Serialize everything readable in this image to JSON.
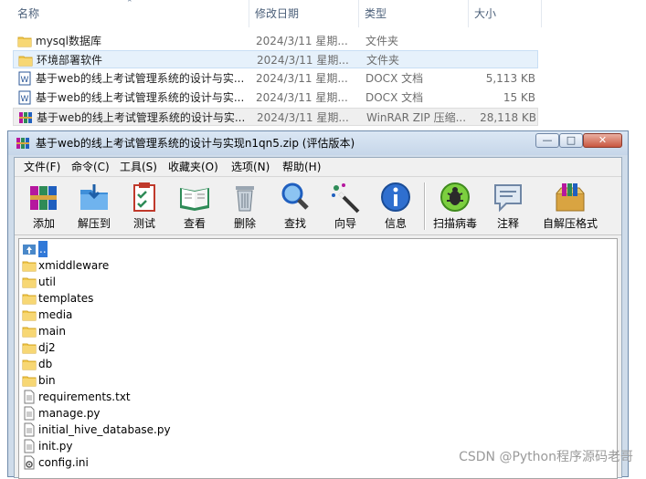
{
  "explorer": {
    "columns": {
      "name": "名称",
      "date": "修改日期",
      "type": "类型",
      "size": "大小"
    },
    "rows": [
      {
        "icon": "folder-icon",
        "name": "mysql数据库",
        "date": "2024/3/11 星期...",
        "type": "文件夹",
        "size": ""
      },
      {
        "icon": "folder-icon",
        "name": "环境部署软件",
        "date": "2024/3/11 星期...",
        "type": "文件夹",
        "size": ""
      },
      {
        "icon": "word-doc-icon",
        "name": "基于web的线上考试管理系统的设计与实...",
        "date": "2024/3/11 星期...",
        "type": "DOCX 文档",
        "size": "5,113 KB"
      },
      {
        "icon": "word-doc-icon",
        "name": "基于web的线上考试管理系统的设计与实...",
        "date": "2024/3/11 星期...",
        "type": "DOCX 文档",
        "size": "15 KB"
      },
      {
        "icon": "winrar-archive-icon",
        "name": "基于web的线上考试管理系统的设计与实...",
        "date": "2024/3/11 星期...",
        "type": "WinRAR ZIP 压缩...",
        "size": "28,118 KB"
      }
    ]
  },
  "rar": {
    "title": "基于web的线上考试管理系统的设计与实现n1qn5.zip (评估版本)",
    "window_buttons": {
      "minimize": "—",
      "maximize": "□",
      "close": "✕"
    },
    "menu": [
      "文件(F)",
      "命令(C)",
      "工具(S)",
      "收藏夹(O)",
      "选项(N)",
      "帮助(H)"
    ],
    "toolbar": [
      {
        "icon": "add-icon",
        "label": "添加"
      },
      {
        "icon": "extract-to-icon",
        "label": "解压到"
      },
      {
        "icon": "test-icon",
        "label": "测试"
      },
      {
        "icon": "view-icon",
        "label": "查看"
      },
      {
        "icon": "delete-icon",
        "label": "删除"
      },
      {
        "icon": "find-icon",
        "label": "查找"
      },
      {
        "icon": "wizard-icon",
        "label": "向导"
      },
      {
        "icon": "info-icon",
        "label": "信息"
      },
      {
        "icon": "virus-scan-icon",
        "label": "扫描病毒"
      },
      {
        "icon": "comment-icon",
        "label": "注释"
      },
      {
        "icon": "sfx-icon",
        "label": "自解压格式"
      }
    ],
    "files": [
      {
        "icon": "up-folder-icon",
        "name": ".."
      },
      {
        "icon": "folder-icon",
        "name": "xmiddleware"
      },
      {
        "icon": "folder-icon",
        "name": "util"
      },
      {
        "icon": "folder-icon",
        "name": "templates"
      },
      {
        "icon": "folder-icon",
        "name": "media"
      },
      {
        "icon": "folder-icon",
        "name": "main"
      },
      {
        "icon": "folder-icon",
        "name": "dj2"
      },
      {
        "icon": "folder-icon",
        "name": "db"
      },
      {
        "icon": "folder-icon",
        "name": "bin"
      },
      {
        "icon": "text-file-icon",
        "name": "requirements.txt"
      },
      {
        "icon": "text-file-icon",
        "name": "manage.py"
      },
      {
        "icon": "text-file-icon",
        "name": "initial_hive_database.py"
      },
      {
        "icon": "text-file-icon",
        "name": "init.py"
      },
      {
        "icon": "config-file-icon",
        "name": "config.ini"
      }
    ]
  },
  "watermark": "CSDN @Python程序源码老哥",
  "colors": {
    "folder": "#f2c94c",
    "selection": "#3179d8",
    "titlebar": "#c6d6e9",
    "word": "#2b5797"
  }
}
